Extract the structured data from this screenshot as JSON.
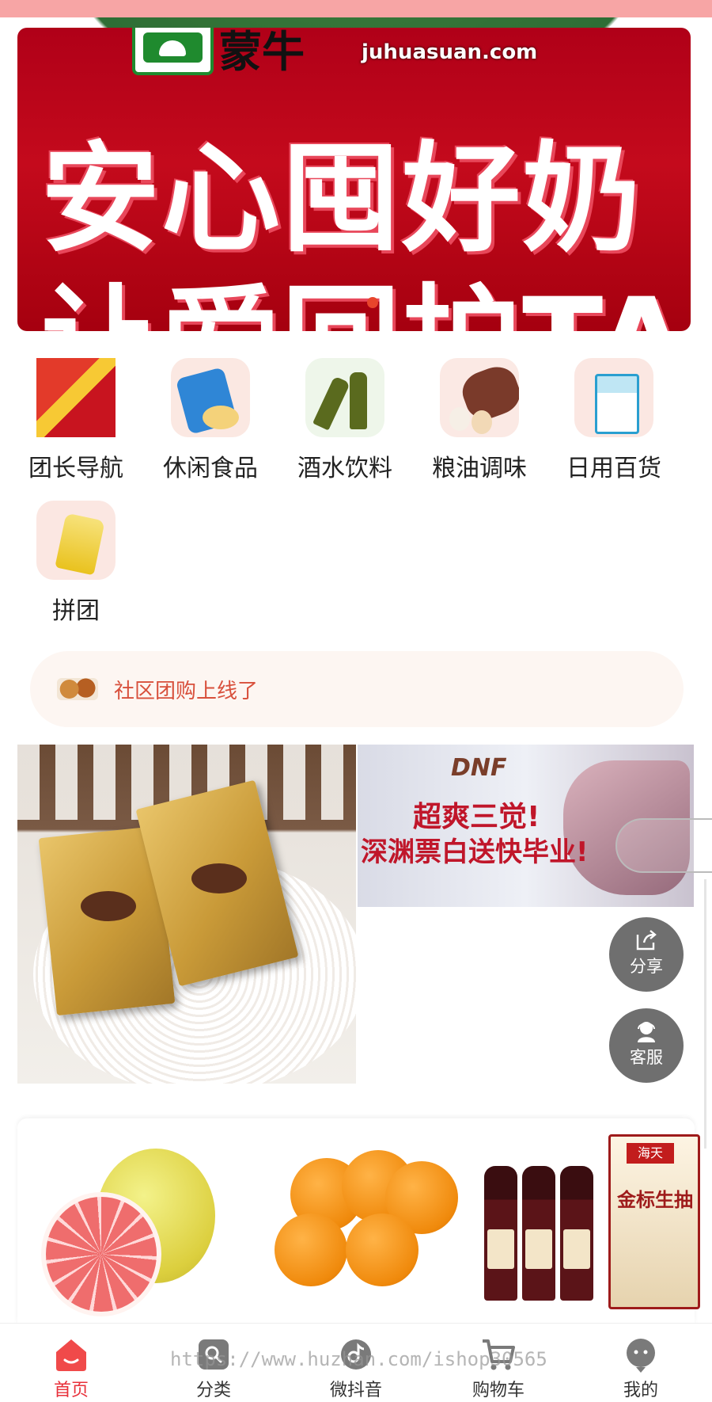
{
  "banner": {
    "brand_logo_text": "MENGNIU",
    "brand_cn": "蒙牛",
    "brand_partner": "聚划算",
    "brand_url": "juhuasuan.com",
    "headline_line1": "安心囤好奶",
    "headline_line2": "让爱回护TA"
  },
  "categories": [
    {
      "label": "团长导航",
      "icon": "leader-nav-icon"
    },
    {
      "label": "休闲食品",
      "icon": "snack-icon"
    },
    {
      "label": "酒水饮料",
      "icon": "drinks-icon"
    },
    {
      "label": "粮油调味",
      "icon": "grain-oil-icon"
    },
    {
      "label": "日用百货",
      "icon": "daily-goods-icon"
    },
    {
      "label": "拼团",
      "icon": "group-buy-icon"
    }
  ],
  "notice": {
    "text": "社区团购上线了",
    "icon": "food-thumb-icon"
  },
  "promos": {
    "left_product": "FERRERO ROCHER",
    "right_logo": "DNF",
    "right_line1": "超爽三觉!",
    "right_line2": "深渊票白送快毕业!"
  },
  "fabs": {
    "share": "分享",
    "service": "客服"
  },
  "products": {
    "sauce_brand": "海天",
    "sauce_label": "金标生抽"
  },
  "tabbar": [
    {
      "label": "首页",
      "icon": "home-icon",
      "active": true
    },
    {
      "label": "分类",
      "icon": "category-search-icon",
      "active": false
    },
    {
      "label": "微抖音",
      "icon": "video-icon",
      "active": false
    },
    {
      "label": "购物车",
      "icon": "cart-icon",
      "active": false
    },
    {
      "label": "我的",
      "icon": "profile-icon",
      "active": false
    }
  ],
  "watermark": "https://www.huzhan.com/ishop30565",
  "colors": {
    "accent": "#e8303a",
    "notice_text": "#d8503c",
    "fab_bg": "#6f6f6f"
  }
}
